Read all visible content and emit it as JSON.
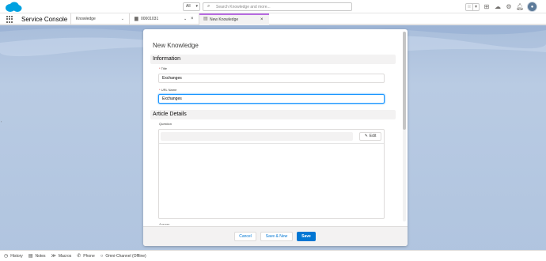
{
  "global_header": {
    "search_scope": "All",
    "search_placeholder": "Search Knowledge and more..."
  },
  "tab_bar": {
    "app_name": "Service Console",
    "nav_item": "Knowledge",
    "tabs": [
      {
        "icon": "case-icon",
        "label": "00001031"
      },
      {
        "icon": "knowledge-icon",
        "label": "New Knowledge"
      }
    ]
  },
  "modal": {
    "title": "New Knowledge",
    "sections": {
      "information": "Information",
      "article_details": "Article Details"
    },
    "fields": {
      "title": {
        "required_mark": "*",
        "label": "Title",
        "value": "Exchanges"
      },
      "url_name": {
        "required_mark": "*",
        "label": "URL Name",
        "value": "Exchanges"
      },
      "question": {
        "label": "Question",
        "edit_label": "Edit"
      },
      "answer": {
        "label": "Answer"
      }
    },
    "footer": {
      "cancel_label": "Cancel",
      "save_new_label": "Save & New",
      "save_label": "Save"
    }
  },
  "utility_bar": {
    "items": [
      {
        "icon": "history-icon",
        "label": "History"
      },
      {
        "icon": "notes-icon",
        "label": "Notes"
      },
      {
        "icon": "macros-icon",
        "label": "Macros"
      },
      {
        "icon": "phone-icon",
        "label": "Phone"
      },
      {
        "icon": "omni-channel-icon",
        "label": "Omni-Channel (Offline)"
      }
    ]
  },
  "colors": {
    "brand": "#0176d3",
    "background": "#b0c4df",
    "active_tab_accent": "#b76ae0",
    "focus_ring": "#1b96ff"
  }
}
